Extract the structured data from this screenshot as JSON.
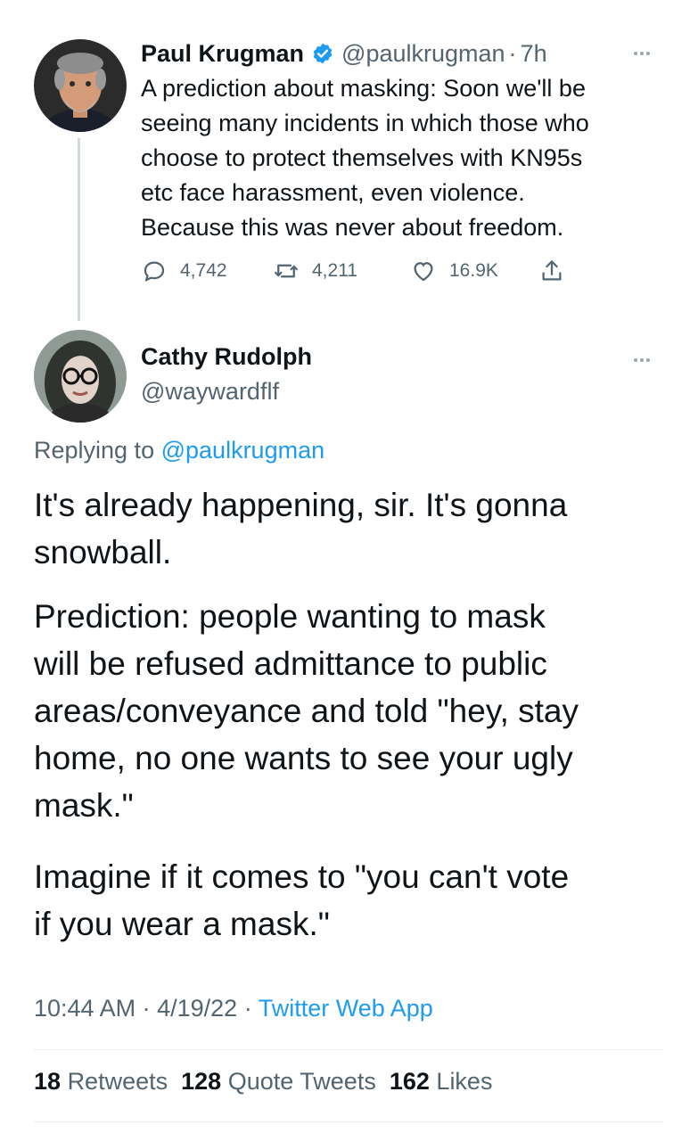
{
  "parent_tweet": {
    "author_name": "Paul Krugman",
    "handle": "@paulkrugman",
    "separator": "·",
    "time": "7h",
    "text_lines": [
      "A prediction about masking: Soon we'll be",
      "seeing many incidents in which those who",
      "choose to protect themselves with KN95s",
      "etc face harassment, even violence.",
      "Because this was never about freedom."
    ],
    "replies": "4,742",
    "retweets": "4,211",
    "likes": "16.9K",
    "avatar_icon": "person-photo-avatar",
    "verified_icon": "verified-badge-icon",
    "accent_color": "#1d9bf0"
  },
  "reply_tweet": {
    "author_name": "Cathy Rudolph",
    "handle": "@waywardflf",
    "replying_to_prefix": "Replying to",
    "replying_to_handle": "@paulkrugman",
    "paragraph1": [
      "It's already happening, sir. It's gonna",
      "snowball."
    ],
    "paragraph2": [
      "Prediction: people wanting to mask",
      "will be refused admittance to public",
      "areas/conveyance and told \"hey, stay",
      "home, no one wants to see your ugly",
      "mask.\""
    ],
    "paragraph3": [
      "Imagine if it comes to \"you can't vote",
      "if you wear a mask.\""
    ],
    "time": "10:44 AM",
    "separator": "·",
    "date": "4/19/22",
    "source": "Twitter Web App",
    "stats": {
      "retweets_count": "18",
      "retweets_label": "Retweets",
      "quote_count": "128",
      "quote_label": "Quote Tweets",
      "likes_count": "162",
      "likes_label": "Likes"
    }
  }
}
